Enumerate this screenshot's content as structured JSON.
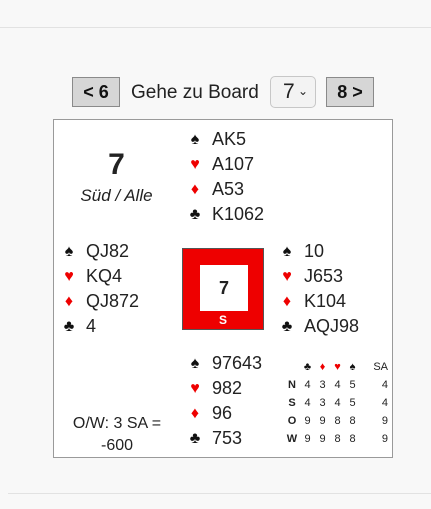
{
  "nav": {
    "prev_label": "< 6",
    "goto_label": "Gehe zu Board",
    "select_value": "7",
    "next_label": "8 >"
  },
  "board": {
    "number": "7",
    "dealer_vul": "Süd / Alle",
    "north": {
      "spades": "AK5",
      "hearts": "A107",
      "diamonds": "A53",
      "clubs": "K1062"
    },
    "west": {
      "spades": "QJ82",
      "hearts": "KQ4",
      "diamonds": "QJ872",
      "clubs": "4"
    },
    "east": {
      "spades": "10",
      "hearts": "J653",
      "diamonds": "K104",
      "clubs": "AQJ98"
    },
    "south": {
      "spades": "97643",
      "hearts": "982",
      "diamonds": "96",
      "clubs": "753"
    },
    "compass": {
      "number": "7",
      "dealer_seat": "S"
    },
    "contract_line1": "O/W: 3 SA =",
    "contract_line2": "-600"
  },
  "suits": {
    "spade": "♠",
    "heart": "♥",
    "diamond": "♦",
    "club": "♣"
  },
  "colors": {
    "red": "#ee0000",
    "compass_red": "#ee0000"
  },
  "dd_table": {
    "nt_header": "SA",
    "rows": [
      {
        "seat": "N",
        "c": "4",
        "d": "3",
        "h": "4",
        "s": "5",
        "nt": "4"
      },
      {
        "seat": "S",
        "c": "4",
        "d": "3",
        "h": "4",
        "s": "5",
        "nt": "4"
      },
      {
        "seat": "O",
        "c": "9",
        "d": "9",
        "h": "8",
        "s": "8",
        "nt": "9"
      },
      {
        "seat": "W",
        "c": "9",
        "d": "9",
        "h": "8",
        "s": "8",
        "nt": "9"
      }
    ]
  }
}
